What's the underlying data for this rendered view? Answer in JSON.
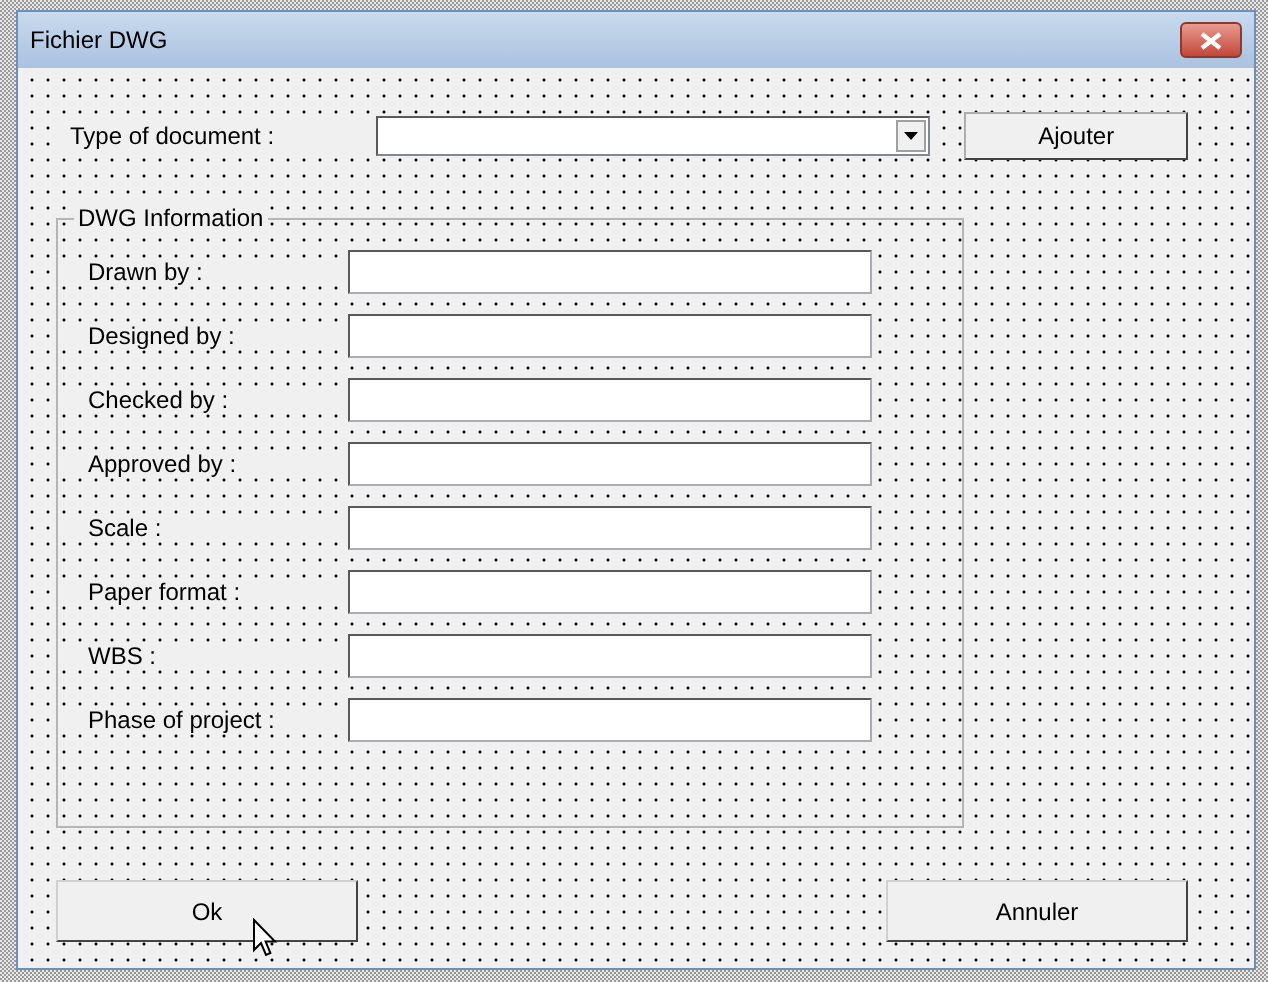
{
  "window": {
    "title": "Fichier DWG"
  },
  "document_type": {
    "label": "Type of document :"
  },
  "add_button": "Ajouter",
  "frame": {
    "title": "DWG Information",
    "fields": [
      {
        "label": "Drawn by :"
      },
      {
        "label": "Designed by :"
      },
      {
        "label": "Checked by :"
      },
      {
        "label": "Approved by :"
      },
      {
        "label": "Scale :"
      },
      {
        "label": "Paper format :"
      },
      {
        "label": "WBS :"
      },
      {
        "label": "Phase of project :"
      }
    ]
  },
  "buttons": [
    "Ok",
    "Annuler"
  ]
}
